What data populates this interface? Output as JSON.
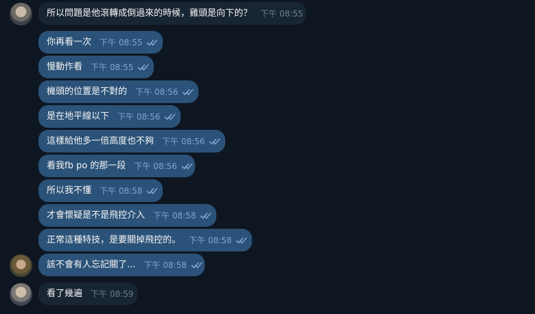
{
  "colors": {
    "background": "#0e1621",
    "incoming_bubble": "#182533",
    "outgoing_bubble": "#2b5278",
    "read_ticks": "#7da8d3"
  },
  "messages": [
    {
      "text": "所以問題是他滾轉成倒過來的時候，雞頭是向下的？",
      "time": "下午 08:55",
      "direction": "incoming"
    },
    {
      "text": "你再看一次",
      "time": "下午 08:55",
      "direction": "outgoing"
    },
    {
      "text": "慢動作看",
      "time": "下午 08:55",
      "direction": "outgoing"
    },
    {
      "text": "機頭的位置是不對的",
      "time": "下午 08:56",
      "direction": "outgoing"
    },
    {
      "text": "是在地平線以下",
      "time": "下午 08:56",
      "direction": "outgoing"
    },
    {
      "text": "這樣給他多一倍高度也不夠",
      "time": "下午 08:56",
      "direction": "outgoing"
    },
    {
      "text": "看我fb po 的那一段",
      "time": "下午 08:56",
      "direction": "outgoing"
    },
    {
      "text": "所以我不懂",
      "time": "下午 08:58",
      "direction": "outgoing"
    },
    {
      "text": "才會懷疑是不是飛控介入",
      "time": "下午 08:58",
      "direction": "outgoing"
    },
    {
      "text": "正常這種特技，是要關掉飛控的。",
      "time": "下午 08:58",
      "direction": "outgoing"
    },
    {
      "text": "該不會有人忘記關了...",
      "time": "下午 08:58",
      "direction": "outgoing"
    },
    {
      "text": "看了幾遍",
      "time": "下午 08:59",
      "direction": "incoming"
    }
  ],
  "icons": {
    "avatar": "user-avatar",
    "ticks": "double-check-icon"
  }
}
